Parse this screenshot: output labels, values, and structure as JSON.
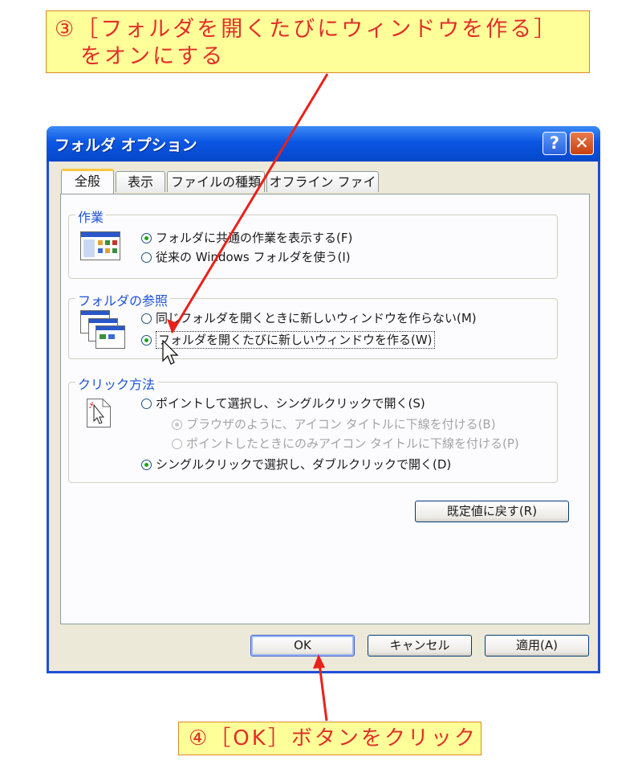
{
  "callouts": {
    "top_line1": "③［フォルダを開くたびにウィンドウを作る］",
    "top_line2": "をオンにする",
    "bottom": "④［OK］ボタンをクリック"
  },
  "window": {
    "title": "フォルダ オプション",
    "help_glyph": "?",
    "close_glyph": "✕"
  },
  "tabs": [
    {
      "label": "全般",
      "active": true
    },
    {
      "label": "表示",
      "active": false
    },
    {
      "label": "ファイルの種類",
      "active": false
    },
    {
      "label": "オフライン ファイル",
      "active": false
    }
  ],
  "groups": {
    "tasks": {
      "title": "作業",
      "options": [
        {
          "label": "フォルダに共通の作業を表示する(F)",
          "selected": true
        },
        {
          "label": "従来の Windows フォルダを使う(I)",
          "selected": false
        }
      ]
    },
    "browse": {
      "title": "フォルダの参照",
      "options": [
        {
          "label": "同じフォルダを開くときに新しいウィンドウを作らない(M)",
          "selected": false
        },
        {
          "label": "フォルダを開くたびに新しいウィンドウを作る(W)",
          "selected": true
        }
      ]
    },
    "click": {
      "title": "クリック方法",
      "options": [
        {
          "label": "ポイントして選択し、シングルクリックで開く(S)",
          "selected": false
        },
        {
          "label": "ブラウザのように、アイコン タイトルに下線を付ける(B)",
          "selected": true,
          "disabled": true
        },
        {
          "label": "ポイントしたときにのみアイコン タイトルに下線を付ける(P)",
          "selected": false,
          "disabled": true
        },
        {
          "label": "シングルクリックで選択し、ダブルクリックで開く(D)",
          "selected": true
        }
      ]
    }
  },
  "buttons": {
    "restore": "既定値に戻す(R)",
    "ok": "OK",
    "cancel": "キャンセル",
    "apply": "適用(A)"
  },
  "colors": {
    "callout_text": "#e0302a",
    "callout_bg": "#ffff99",
    "titlebar": "#0a56e3",
    "group_title": "#1f52d8",
    "arrow": "#e8211b"
  }
}
